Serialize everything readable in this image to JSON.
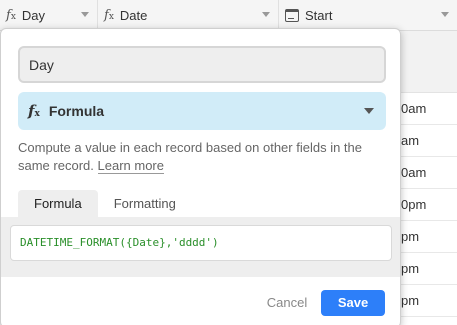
{
  "grid": {
    "columns": [
      {
        "label": "Day",
        "icon": "formula-icon",
        "icon_glyph": "f"
      },
      {
        "label": "Date",
        "icon": "formula-icon",
        "icon_glyph": "f"
      },
      {
        "label": "Start",
        "icon": "calendar-icon",
        "icon_glyph": ""
      }
    ],
    "start_cells": [
      "0am",
      "am",
      "0am",
      "0pm",
      "pm",
      "pm",
      "pm"
    ]
  },
  "popup": {
    "field_name": "Day",
    "field_type": "Formula",
    "field_type_icon": "formula-icon",
    "description": "Compute a value in each record based on other fields in the same record.",
    "learn_more": "Learn more",
    "tabs": [
      {
        "label": "Formula",
        "active": true
      },
      {
        "label": "Formatting",
        "active": false
      }
    ],
    "formula": "DATETIME_FORMAT({Date},'dddd')",
    "cancel_label": "Cancel",
    "save_label": "Save"
  },
  "colors": {
    "accent": "#2d7ff9",
    "type_bg": "#d1ecf8",
    "formula_text": "#2a8f2a"
  }
}
